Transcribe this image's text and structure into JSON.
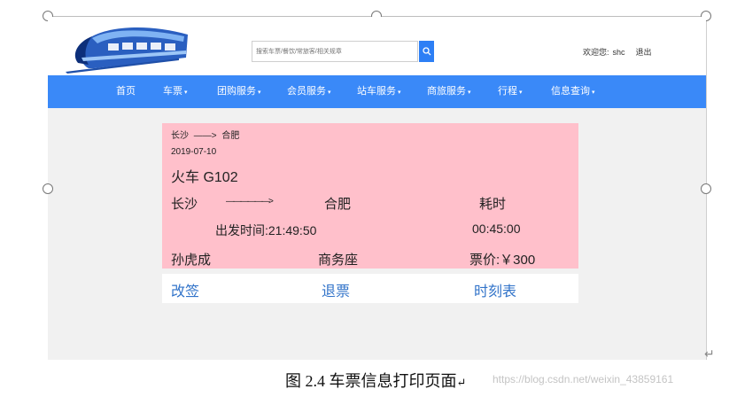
{
  "header": {
    "search": {
      "placeholder": "搜索车票/餐饮/常旅客/相关规章"
    },
    "user": {
      "welcome": "欢迎您:",
      "name": "shc",
      "logout": "退出"
    }
  },
  "nav": {
    "items": [
      {
        "label": "首页",
        "has_caret": false
      },
      {
        "label": "车票",
        "has_caret": true
      },
      {
        "label": "团购服务",
        "has_caret": true
      },
      {
        "label": "会员服务",
        "has_caret": true
      },
      {
        "label": "站车服务",
        "has_caret": true
      },
      {
        "label": "商旅服务",
        "has_caret": true
      },
      {
        "label": "行程",
        "has_caret": true
      },
      {
        "label": "信息查询",
        "has_caret": true
      }
    ],
    "caret": "▾"
  },
  "ticket": {
    "route_from": "长沙",
    "route_arrow": "——>",
    "route_to": "合肥",
    "date": "2019-07-10",
    "train": "火车 G102",
    "from_station": "长沙",
    "long_arrow": "——————>",
    "to_station": "合肥",
    "duration_label": "耗时",
    "depart_time": "出发时间:21:49:50",
    "duration": "00:45:00",
    "passenger": "孙虎成",
    "seat_class": "商务座",
    "price": "票价:￥300"
  },
  "actions": {
    "change": "改签",
    "refund": "退票",
    "timetable": "时刻表"
  },
  "caption": "图 2.4 车票信息打印页面",
  "caption_mark": "↵",
  "watermark": "https://blog.csdn.net/weixin_43859161",
  "return_mark": "↵",
  "colors": {
    "nav_bg": "#3a89f8",
    "ticket_bg": "#ffc0cb",
    "link": "#3173c9",
    "search_btn": "#2d7ff5"
  }
}
